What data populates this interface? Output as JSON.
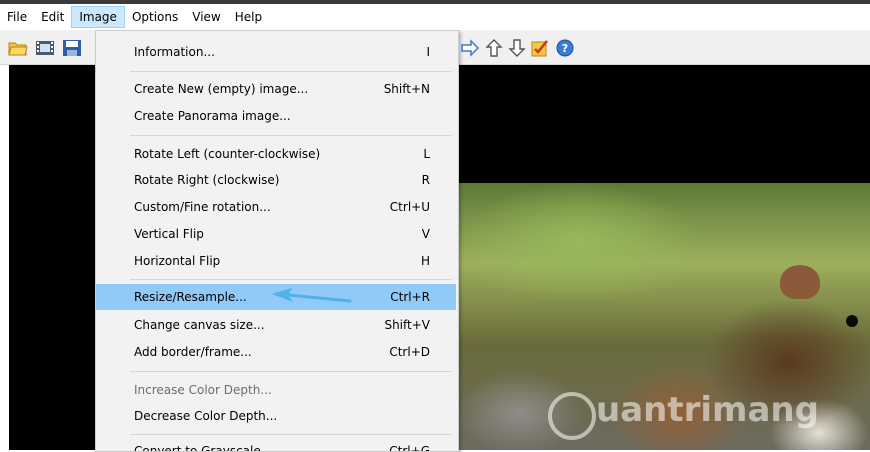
{
  "menubar": {
    "items": [
      {
        "label": "File"
      },
      {
        "label": "Edit"
      },
      {
        "label": "Image"
      },
      {
        "label": "Options"
      },
      {
        "label": "View"
      },
      {
        "label": "Help"
      }
    ],
    "active": "Image"
  },
  "toolbar": {
    "icons": [
      "open-folder-icon",
      "filmstrip-icon",
      "save-icon",
      "arrow-right-icon",
      "arrow-up-icon",
      "arrow-down-icon",
      "checkbox-icon",
      "help-icon"
    ]
  },
  "image_menu": {
    "items": [
      {
        "label": "Information...",
        "shortcut": "I"
      },
      {
        "label": "Create New (empty) image...",
        "shortcut": "Shift+N"
      },
      {
        "label": "Create Panorama image...",
        "shortcut": ""
      },
      {
        "label": "Rotate Left (counter-clockwise)",
        "shortcut": "L"
      },
      {
        "label": "Rotate Right (clockwise)",
        "shortcut": "R"
      },
      {
        "label": "Custom/Fine rotation...",
        "shortcut": "Ctrl+U"
      },
      {
        "label": "Vertical Flip",
        "shortcut": "V"
      },
      {
        "label": "Horizontal Flip",
        "shortcut": "H"
      },
      {
        "label": "Resize/Resample...",
        "shortcut": "Ctrl+R"
      },
      {
        "label": "Change canvas size...",
        "shortcut": "Shift+V"
      },
      {
        "label": "Add border/frame...",
        "shortcut": "Ctrl+D"
      },
      {
        "label": "Increase Color Depth...",
        "shortcut": ""
      },
      {
        "label": "Decrease Color Depth...",
        "shortcut": ""
      },
      {
        "label": "Convert to Grayscale",
        "shortcut": "Ctrl+G"
      }
    ],
    "highlighted": "Resize/Resample..."
  },
  "watermark": {
    "text": "uantrimang"
  },
  "colors": {
    "highlight": "#91c9f7",
    "arrow": "#4fb3e8",
    "menu_bg": "#f2f2f2"
  }
}
